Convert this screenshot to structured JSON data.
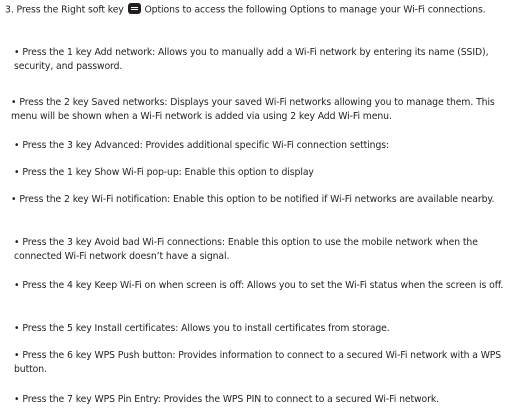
{
  "intro": {
    "before_icon": "3. Press the Right soft key",
    "icon": "menu-icon",
    "after_icon": "Options to access the following Options to manage your Wi-Fi connections."
  },
  "items": [
    {
      "bullet": "•",
      "text": "Press the 1 key Add network: Allows you to manually add a Wi-Fi network by entering its name (SSID), security, and password."
    },
    {
      "bullet": "•",
      "text": "Press the 2 key Saved networks: Displays your saved Wi-Fi networks allowing you to manage them. This menu will be shown when a Wi-Fi network is added via using 2 key Add Wi-Fi menu."
    },
    {
      "bullet": "•",
      "text": "Press the 3 key Advanced: Provides additional specific Wi-Fi connection settings:"
    },
    {
      "bullet": "•",
      "text": "Press the 1 key Show Wi-Fi pop-up: Enable this option to display"
    },
    {
      "bullet": "•",
      "text": "Press the 2 key Wi-Fi notification: Enable this option to be notified if Wi-Fi networks are available nearby."
    },
    {
      "bullet": "•",
      "text": "Press the 3 key Avoid bad Wi-Fi connections: Enable this option to use the mobile network when the connected Wi-Fi network doesn’t have a signal."
    },
    {
      "bullet": "•",
      "text": "Press the 4 key Keep Wi-Fi on when screen is off: Allows you to set the Wi-Fi status when the screen is off."
    },
    {
      "bullet": "•",
      "text": "Press the 5 key Install certificates: Allows you to install certificates from storage."
    },
    {
      "bullet": "•",
      "text": "Press the 6 key WPS Push button: Provides information to connect to a secured Wi-Fi network with a WPS button."
    },
    {
      "bullet": "•",
      "text": "Press the 7 key WPS Pin Entry: Provides the WPS PIN to connect to a secured Wi-Fi network."
    }
  ]
}
